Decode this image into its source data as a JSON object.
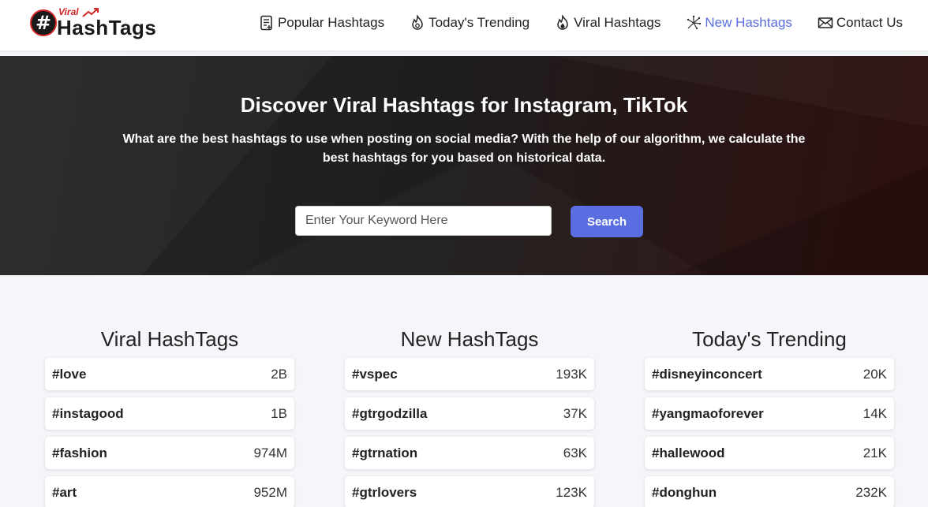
{
  "logo": {
    "badge": "#",
    "small": "Viral",
    "text": "HashTags"
  },
  "nav": [
    {
      "label": "Popular Hashtags",
      "icon": "document-icon"
    },
    {
      "label": "Today's Trending",
      "icon": "flame-icon"
    },
    {
      "label": "Viral Hashtags",
      "icon": "fire-icon"
    },
    {
      "label": "New Hashtags",
      "icon": "sparkle-icon"
    },
    {
      "label": "Contact Us",
      "icon": "mail-icon"
    }
  ],
  "hero": {
    "title": "Discover Viral Hashtags for Instagram, TikTok",
    "description": "What are the best hashtags to use when posting on social media? With the help of our algorithm, we calculate the best hashtags for you based on historical data.",
    "search_placeholder": "Enter Your Keyword Here",
    "search_button": "Search"
  },
  "columns": [
    {
      "title": "Viral HashTags",
      "tags": [
        {
          "name": "#love",
          "count": "2B"
        },
        {
          "name": "#instagood",
          "count": "1B"
        },
        {
          "name": "#fashion",
          "count": "974M"
        },
        {
          "name": "#art",
          "count": "952M"
        }
      ]
    },
    {
      "title": "New HashTags",
      "tags": [
        {
          "name": "#vspec",
          "count": "193K"
        },
        {
          "name": "#gtrgodzilla",
          "count": "37K"
        },
        {
          "name": "#gtrnation",
          "count": "63K"
        },
        {
          "name": "#gtrlovers",
          "count": "123K"
        }
      ]
    },
    {
      "title": "Today's Trending",
      "tags": [
        {
          "name": "#disneyinconcert",
          "count": "20K"
        },
        {
          "name": "#yangmaoforever",
          "count": "14K"
        },
        {
          "name": "#hallewood",
          "count": "21K"
        },
        {
          "name": "#donghun",
          "count": "232K"
        }
      ]
    }
  ],
  "colors": {
    "accent": "#5b6ee1",
    "brand_red": "#d32323"
  }
}
